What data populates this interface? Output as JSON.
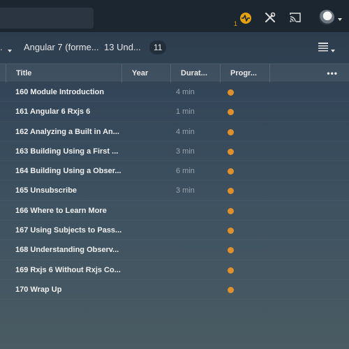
{
  "topbar": {
    "activity_count": "1"
  },
  "toolbar": {
    "crumb_prefix": ".",
    "breadcrumb_library": "Angular 7 (forme...",
    "breadcrumb_section": "13 Und...",
    "item_count": "11"
  },
  "table": {
    "columns": {
      "title": "Title",
      "year": "Year",
      "duration": "Durat...",
      "progress": "Progr...",
      "more": "•••"
    },
    "rows": [
      {
        "title": "160 Module Introduction",
        "duration": "4 min"
      },
      {
        "title": "161 Angular 6 Rxjs 6",
        "duration": "1 min"
      },
      {
        "title": "162 Analyzing a Built in An...",
        "duration": "4 min"
      },
      {
        "title": "163 Building Using a First ...",
        "duration": "3 min"
      },
      {
        "title": "164 Building Using a Obser...",
        "duration": "6 min"
      },
      {
        "title": "165 Unsubscribe",
        "duration": "3 min"
      },
      {
        "title": "166 Where to Learn More",
        "duration": ""
      },
      {
        "title": "167 Using Subjects to Pass...",
        "duration": ""
      },
      {
        "title": "168 Understanding Observ...",
        "duration": ""
      },
      {
        "title": "169 Rxjs 6 Without Rxjs Co...",
        "duration": ""
      },
      {
        "title": "170 Wrap Up",
        "duration": ""
      }
    ]
  },
  "colors": {
    "accent": "#e5a00d",
    "progress_dot": "#e0902a",
    "topbar_bg": "#1b2631"
  },
  "icons": [
    "activity-icon",
    "tools-icon",
    "cast-icon",
    "avatar",
    "chevron-down-icon",
    "list-view-icon",
    "more-icon"
  ]
}
